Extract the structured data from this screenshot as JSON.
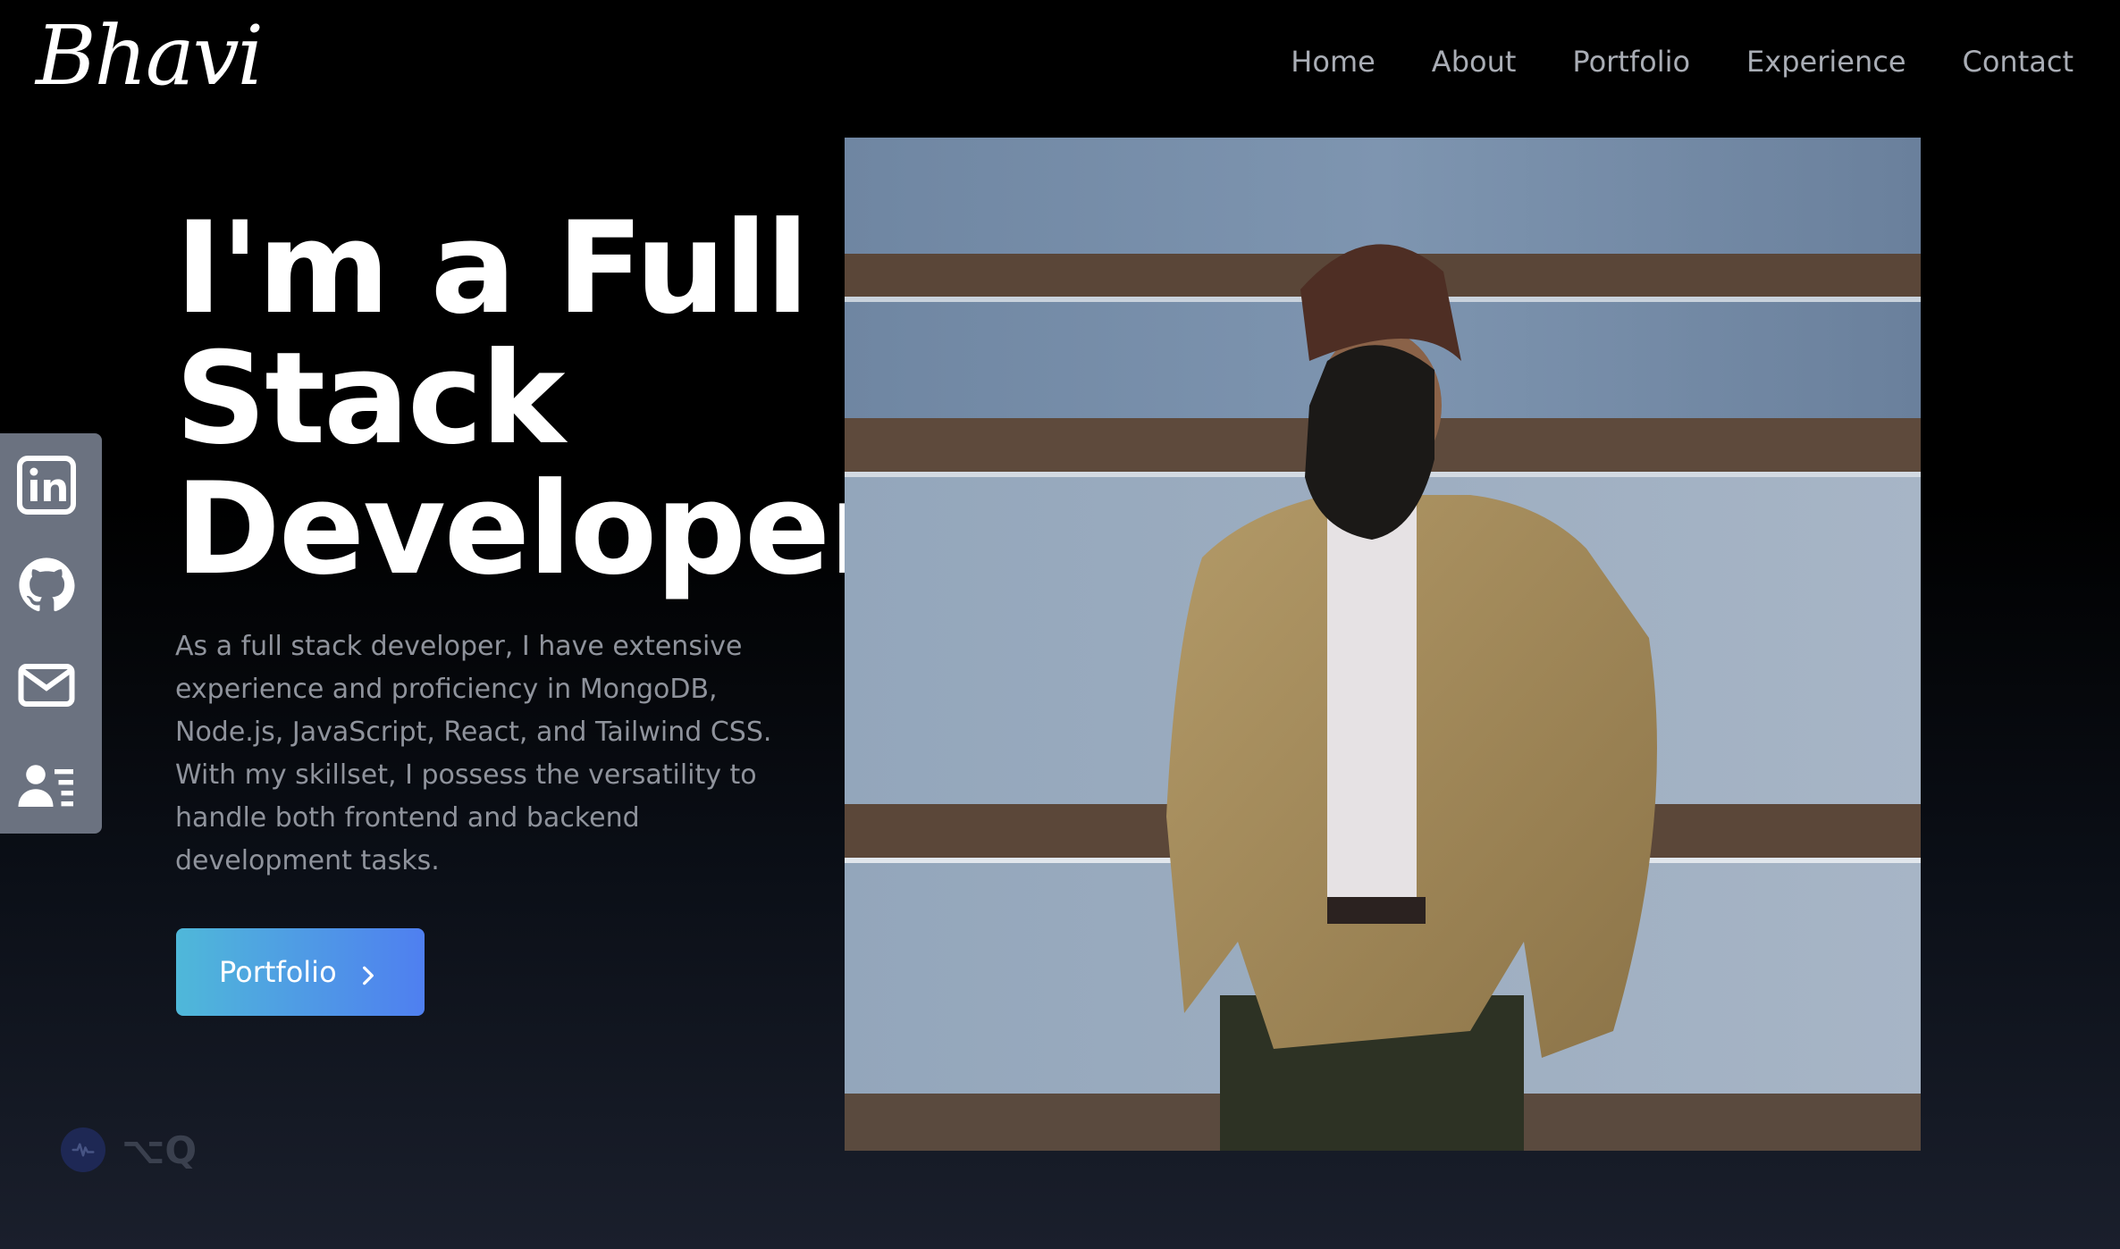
{
  "brand": {
    "logo_text": "Bhavi"
  },
  "nav": {
    "items": [
      {
        "label": "Home"
      },
      {
        "label": "About"
      },
      {
        "label": "Portfolio"
      },
      {
        "label": "Experience"
      },
      {
        "label": "Contact"
      }
    ]
  },
  "social": {
    "icons": [
      "linkedin-icon",
      "github-icon",
      "mail-icon",
      "resume-icon"
    ]
  },
  "hero": {
    "title_lines": [
      "I'm a Full",
      "Stack",
      "Developer"
    ],
    "description": "As a full stack developer, I have extensive experience and proficiency in MongoDB, Node.js, JavaScript, React, and Tailwind CSS. With my skillset, I possess the versatility to handle both frontend and backend development tasks.",
    "cta_label": "Portfolio"
  },
  "widget": {
    "shortcut_text": "⌥Q"
  },
  "colors": {
    "cta_start": "#4fb8d9",
    "cta_end": "#4f7ff0",
    "sidebar_bg": "#6b7280",
    "nav_text": "#a9adb5",
    "desc_text": "#8f939c"
  }
}
